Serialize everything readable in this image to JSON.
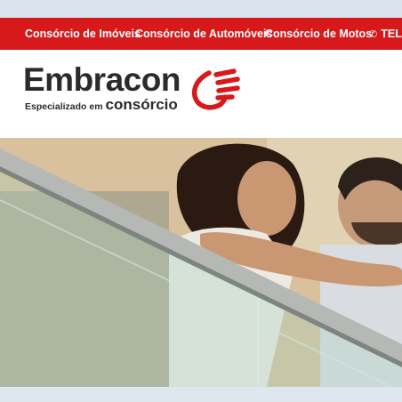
{
  "colors": {
    "brand_red": "#d7191c",
    "text_dark": "#2b2b2b",
    "white": "#ffffff"
  },
  "nav": {
    "items": [
      {
        "label": "Consórcio de Imóveis"
      },
      {
        "label": "Consórcio de Automóveis"
      },
      {
        "label": "Consórcio de Motos"
      }
    ],
    "phone_icon": "phone-icon",
    "phone_label": "TELE"
  },
  "brand": {
    "name": "Embracon",
    "tagline_small": "Especializado em",
    "tagline_big": "consórcio",
    "logo_icon": "hand-logo-icon"
  },
  "hero": {
    "image": "couple-on-escalator-photo"
  }
}
